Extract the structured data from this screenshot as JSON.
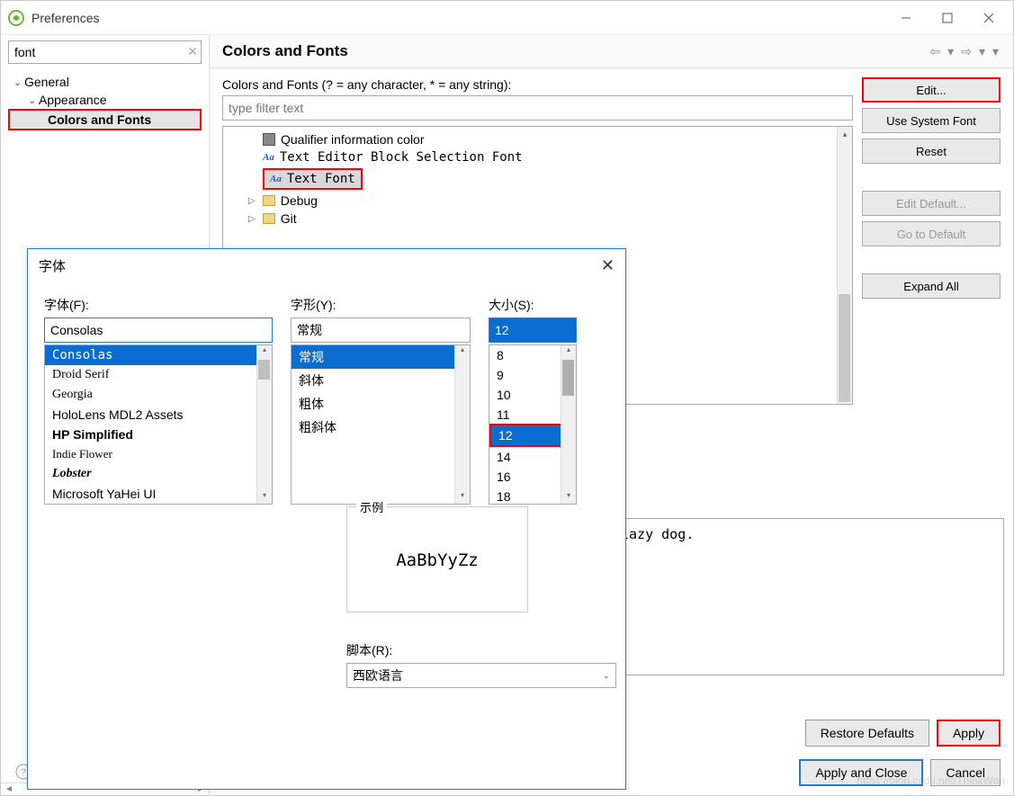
{
  "window": {
    "title": "Preferences"
  },
  "sidebar": {
    "filter_value": "font",
    "items": [
      {
        "label": "General",
        "level": 1,
        "expanded": true
      },
      {
        "label": "Appearance",
        "level": 2,
        "expanded": true
      },
      {
        "label": "Colors and Fonts",
        "level": 3,
        "selected": true
      }
    ]
  },
  "content": {
    "title": "Colors and Fonts",
    "filter_label": "Colors and Fonts (? = any character, * = any string):",
    "filter_placeholder": "type filter text",
    "tree": [
      {
        "icon": "square",
        "label": "Qualifier information color",
        "mono": false
      },
      {
        "icon": "aa",
        "label": "Text Editor Block Selection Font",
        "mono": true
      },
      {
        "icon": "aa",
        "label": "Text Font",
        "mono": true,
        "selected": true
      },
      {
        "icon": "folder",
        "caret": "▷",
        "label": "Debug"
      },
      {
        "icon": "folder",
        "caret": "▷",
        "label": "Git",
        "partial": true
      }
    ],
    "buttons": {
      "edit": "Edit...",
      "use_system": "Use System Font",
      "reset": "Reset",
      "edit_default": "Edit Default...",
      "go_default": "Go to Default",
      "expand_all": "Expand All"
    },
    "preview_text": "lazy dog.",
    "footer": {
      "restore": "Restore Defaults",
      "apply": "Apply",
      "apply_close": "Apply and Close",
      "cancel": "Cancel"
    }
  },
  "font_dialog": {
    "title": "字体",
    "font_label": "字体(F):",
    "font_value": "Consolas",
    "font_list": [
      "Consolas",
      "Droid Serif",
      "Georgia",
      "HoloLens MDL2 Assets",
      "HP Simplified",
      "Indie Flower",
      "Lobster",
      "Microsoft YaHei UI"
    ],
    "style_label": "字形(Y):",
    "style_value": "常规",
    "style_list": [
      "常规",
      "斜体",
      "粗体",
      "粗斜体"
    ],
    "size_label": "大小(S):",
    "size_value": "12",
    "size_list": [
      "8",
      "9",
      "10",
      "11",
      "12",
      "14",
      "16",
      "18"
    ],
    "sample_label": "示例",
    "sample_text": "AaBbYyZz",
    "script_label": "脚本(R):",
    "script_value": "西欧语言"
  },
  "watermark": "https://blog.csdn.net/ThinkWon"
}
